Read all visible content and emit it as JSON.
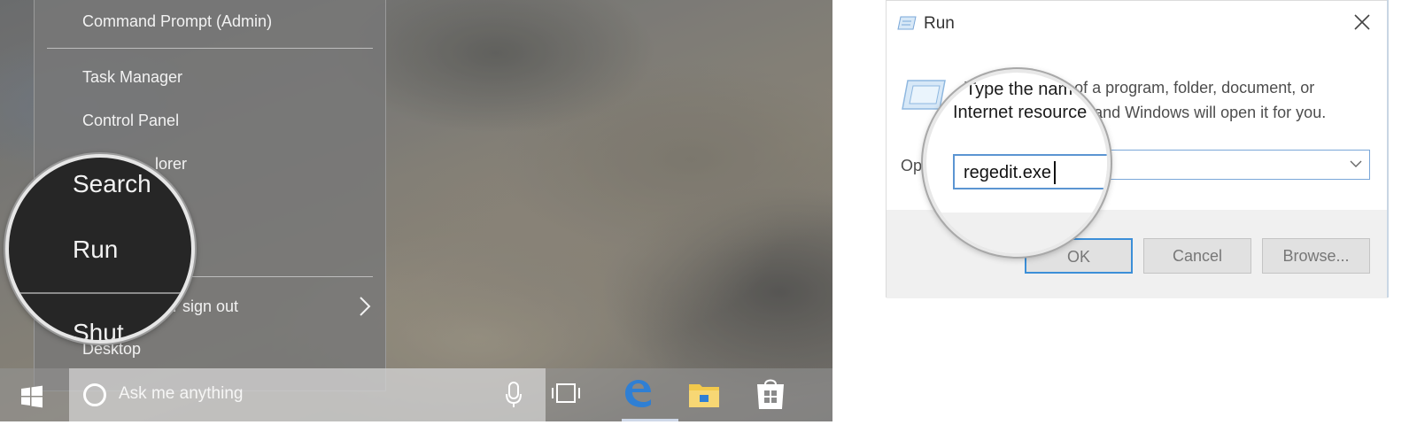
{
  "winx_menu": {
    "items": [
      {
        "label": "Command Prompt (Admin)"
      },
      {
        "label": "Task Manager"
      },
      {
        "label": "Control Panel"
      },
      {
        "label": "lorer"
      },
      {
        "label": "or sign out"
      },
      {
        "label": "Desktop"
      }
    ]
  },
  "taskbar": {
    "search_placeholder": "Ask me anything",
    "icons": [
      "windows-start-icon",
      "cortana-icon",
      "microphone-icon",
      "task-view-icon",
      "edge-icon",
      "file-explorer-icon",
      "store-icon"
    ]
  },
  "magnifier_left": {
    "items": [
      "Search",
      "Run",
      "Shut"
    ]
  },
  "run_dialog": {
    "title": "Run",
    "description_line1": "Type the name of a program, folder, document, or",
    "description_line2": "Internet resource, and Windows will open it for you.",
    "open_label": "Op",
    "open_value": "",
    "buttons": {
      "ok": "OK",
      "cancel": "Cancel",
      "browse": "Browse..."
    },
    "colors": {
      "focus_border": "#3c8fd8",
      "footer_bg": "#f0f0f0"
    }
  },
  "magnifier_right": {
    "line1": "Type the nam",
    "line2": "Internet resource",
    "field_value": "regedit.exe"
  }
}
